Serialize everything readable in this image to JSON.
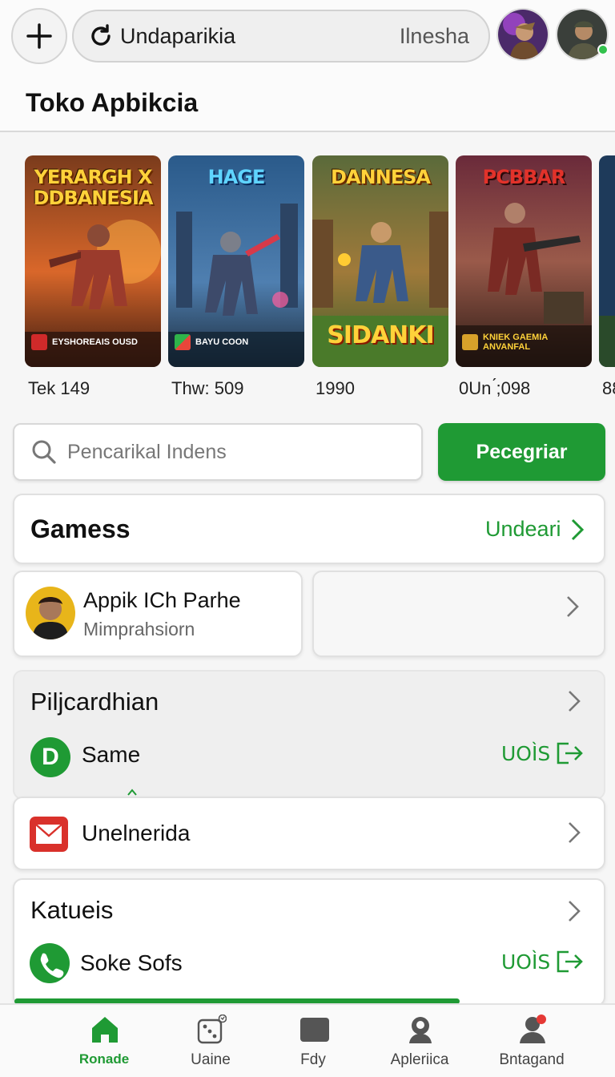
{
  "header": {
    "search_query": "Undaparikia",
    "search_hint": "Ilnesha",
    "store_title": "Toko Apbikcia"
  },
  "carousel": [
    {
      "banner": "YERARGH X DDBANESIA",
      "badge_text": "EYSHOREAIS OUSD",
      "caption": "Tek 149"
    },
    {
      "banner": "HAGE",
      "badge_text": "BAYU COON",
      "caption": "Thw: 509"
    },
    {
      "banner": "DANNESA",
      "bottom_title": "SIDANKI",
      "caption": "1990"
    },
    {
      "banner": "PCBBAR",
      "badge_text": "KNIEK GAEMIA ANVANFAL",
      "caption": "0Un ́;098"
    },
    {
      "caption": "88"
    }
  ],
  "search": {
    "placeholder": "Pencarikal Indens",
    "button": "Pecegriar"
  },
  "games": {
    "title": "Gamess",
    "link": "Undeari"
  },
  "app_card": {
    "name": "Appik ICh Parhe",
    "subtitle": "Mimprahsiorn"
  },
  "pilj": {
    "title": "Pilјcardhian",
    "item_label": "Same",
    "item_letter": "D",
    "item_action": "UOÌS"
  },
  "mail_row": {
    "label": "Unelnerida"
  },
  "katueis": {
    "title": "Katueis",
    "item_label": "Soke Sofs",
    "item_action": "UOÌS"
  },
  "nav": [
    {
      "label": "Ronade",
      "icon": "home-icon",
      "active": true
    },
    {
      "label": "Uaine",
      "icon": "dice-icon",
      "active": false
    },
    {
      "label": "Fdy",
      "icon": "folder-icon",
      "active": false
    },
    {
      "label": "Apleriica",
      "icon": "user-group-icon",
      "active": false
    },
    {
      "label": "Bntagand",
      "icon": "profile-icon",
      "active": false
    }
  ],
  "colors": {
    "accent": "#1f9a34",
    "mail_red": "#d9312b",
    "notification": "#e53935"
  }
}
